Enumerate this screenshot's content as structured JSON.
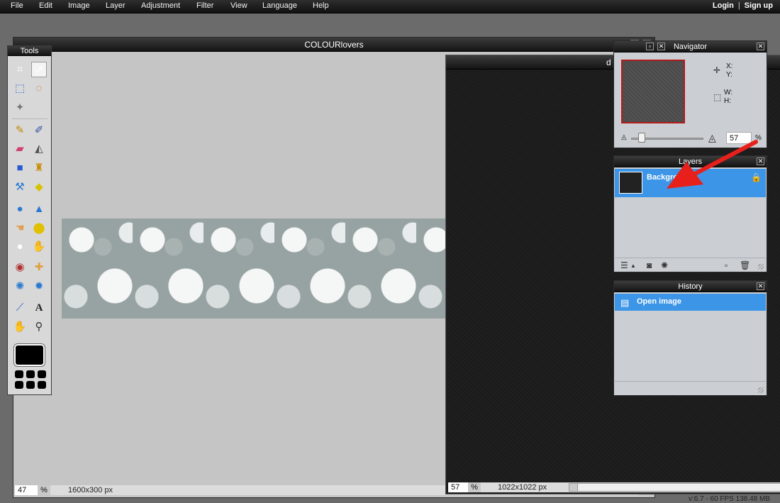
{
  "menu": {
    "items": [
      {
        "label": "File"
      },
      {
        "label": "Edit"
      },
      {
        "label": "Image"
      },
      {
        "label": "Layer"
      },
      {
        "label": "Adjustment"
      },
      {
        "label": "Filter"
      },
      {
        "label": "View"
      },
      {
        "label": "Language"
      },
      {
        "label": "Help"
      }
    ],
    "login": "Login",
    "separator": "|",
    "signup": "Sign up"
  },
  "document": {
    "title": "COLOURlovers",
    "zoom": "47",
    "zoom_unit": "%",
    "dimensions": "1600x300 px"
  },
  "document2": {
    "title": "d",
    "zoom": "57",
    "zoom_unit": "%",
    "dimensions": "1022x1022 px",
    "version": "v:6.7 - 60 FPS 138.48 MB"
  },
  "tools": {
    "title": "Tools",
    "items": [
      {
        "icon": "crop-icon"
      },
      {
        "icon": "move-icon",
        "active": true
      },
      {
        "icon": "marquee-icon"
      },
      {
        "icon": "lasso-icon"
      },
      {
        "icon": "magic-wand-icon"
      },
      {
        "icon": "pencil-icon"
      },
      {
        "icon": "brush-icon"
      },
      {
        "icon": "eraser-icon"
      },
      {
        "icon": "paint-bucket-icon"
      },
      {
        "icon": "gradient-icon"
      },
      {
        "icon": "clone-stamp-icon"
      },
      {
        "icon": "color-replace-icon"
      },
      {
        "icon": "drawing-icon"
      },
      {
        "icon": "blur-icon"
      },
      {
        "icon": "sharpen-icon"
      },
      {
        "icon": "smudge-icon"
      },
      {
        "icon": "sponge-icon"
      },
      {
        "icon": "dodge-icon"
      },
      {
        "icon": "burn-icon"
      },
      {
        "icon": "red-eye-icon"
      },
      {
        "icon": "spot-heal-icon"
      },
      {
        "icon": "bloat-icon"
      },
      {
        "icon": "pinch-icon"
      },
      {
        "icon": "color-picker-icon"
      },
      {
        "icon": "type-icon"
      },
      {
        "icon": "hand-icon"
      },
      {
        "icon": "zoom-icon"
      }
    ],
    "foreground_color": "#000000"
  },
  "navigator": {
    "title": "Navigator",
    "x_label": "X:",
    "y_label": "Y:",
    "w_label": "W:",
    "h_label": "H:",
    "zoom_value": "57",
    "zoom_unit": "%",
    "zoom_level": 0.13
  },
  "layers": {
    "title": "Layers",
    "items": [
      {
        "name": "Background",
        "locked": true,
        "selected": true
      }
    ]
  },
  "history": {
    "title": "History",
    "items": [
      {
        "name": "Open image",
        "selected": true
      }
    ]
  },
  "colors": {
    "selection": "#3c95e6",
    "annotation_arrow": "#e8201c",
    "panel_bg": "#cbcfd3"
  }
}
